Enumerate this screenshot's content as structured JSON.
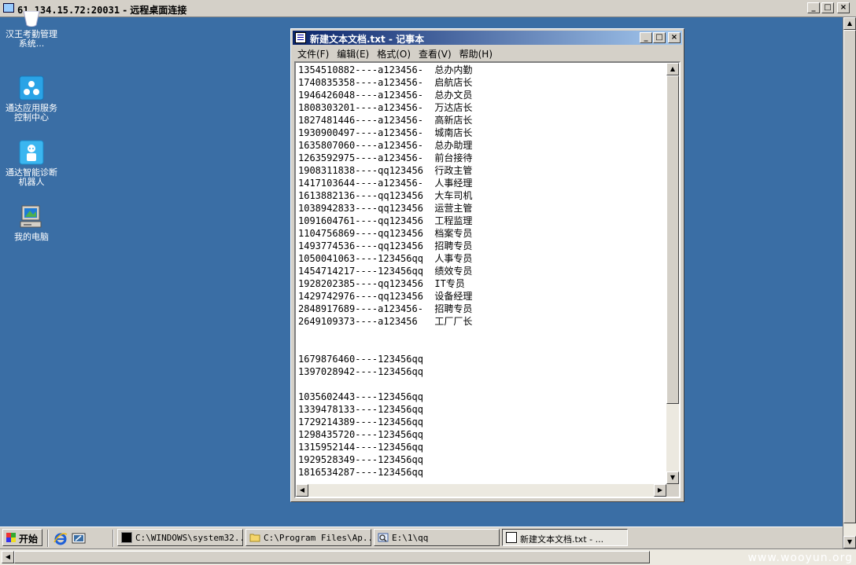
{
  "rdp": {
    "title_address": "61.134.15.72:20031",
    "title_suffix": " - 远程桌面连接",
    "btn_min": "_",
    "btn_max": "□",
    "btn_close": "×"
  },
  "desktop": {
    "icons": [
      {
        "label": "汉王考勤管理系统..."
      },
      {
        "label": "通达应用服务控制中心"
      },
      {
        "label": "通达智能诊断机器人"
      },
      {
        "label": "我的电脑"
      }
    ]
  },
  "notepad": {
    "title": "新建文本文档.txt - 记事本",
    "menu": [
      "文件(F)",
      "编辑(E)",
      "格式(O)",
      "查看(V)",
      "帮助(H)"
    ],
    "lines": [
      "1354510882----a123456-  总办内勤",
      "1740835358----a123456-  启航店长",
      "1946426048----a123456-  总办文员",
      "1808303201----a123456-  万达店长",
      "1827481446----a123456-  高新店长",
      "1930900497----a123456-  城南店长",
      "1635807060----a123456-  总办助理",
      "1263592975----a123456-  前台接待",
      "1908311838----qq123456  行政主管",
      "1417103644----a123456-  人事经理",
      "1613882136----qq123456  大车司机",
      "1038942833----qq123456  运营主管",
      "1091604761----qq123456  工程监理",
      "1104756869----qq123456  档案专员",
      "1493774536----qq123456  招聘专员",
      "1050041063----123456qq  人事专员",
      "1454714217----123456qq  绩效专员",
      "1928202385----qq123456  IT专员",
      "1429742976----qq123456  设备经理",
      "2848917689----a123456-  招聘专员",
      "2649109373----a123456   工厂厂长",
      "",
      "",
      "1679876460----123456qq",
      "1397028942----123456qq",
      "",
      "1035602443----123456qq",
      "1339478133----123456qq",
      "1729214389----123456qq",
      "1298435720----123456qq",
      "1315952144----123456qq",
      "1929528349----123456qq",
      "1816534287----123456qq"
    ],
    "btn_min": "_",
    "btn_max": "□",
    "btn_close": "×"
  },
  "taskbar": {
    "start_label": "开始",
    "tasks": [
      {
        "label": "C:\\WINDOWS\\system32..."
      },
      {
        "label": "C:\\Program Files\\Ap..."
      },
      {
        "label": "E:\\1\\qq"
      },
      {
        "label": "新建文本文档.txt - ..."
      }
    ]
  },
  "watermark": "www.wooyun.org"
}
